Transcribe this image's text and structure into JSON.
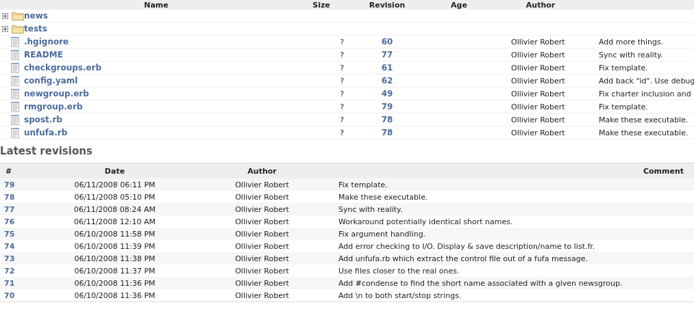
{
  "files": {
    "columns": [
      "Name",
      "Size",
      "Revision",
      "Age",
      "Author"
    ],
    "rows": [
      {
        "kind": "folder",
        "expanded": false,
        "name": "news"
      },
      {
        "kind": "folder",
        "expanded": false,
        "name": "tests"
      },
      {
        "kind": "file",
        "name": ".hgignore",
        "size": "?",
        "revision": "60",
        "author": "Ollivier Robert",
        "comment": "Add more things."
      },
      {
        "kind": "file",
        "name": "README",
        "size": "?",
        "revision": "77",
        "author": "Ollivier Robert",
        "comment": "Sync with reality."
      },
      {
        "kind": "file",
        "name": "checkgroups.erb",
        "size": "?",
        "revision": "61",
        "author": "Ollivier Robert",
        "comment": "Fix template."
      },
      {
        "kind": "file",
        "name": "config.yaml",
        "size": "?",
        "revision": "62",
        "author": "Ollivier Robert",
        "comment": "Add back \"id\". Use debug"
      },
      {
        "kind": "file",
        "name": "newgroup.erb",
        "size": "?",
        "revision": "49",
        "author": "Ollivier Robert",
        "comment": "Fix charter inclusion and"
      },
      {
        "kind": "file",
        "name": "rmgroup.erb",
        "size": "?",
        "revision": "79",
        "author": "Ollivier Robert",
        "comment": "Fix template."
      },
      {
        "kind": "file",
        "name": "spost.rb",
        "size": "?",
        "revision": "78",
        "author": "Ollivier Robert",
        "comment": "Make these executable."
      },
      {
        "kind": "file",
        "name": "unfufa.rb",
        "size": "?",
        "revision": "78",
        "author": "Ollivier Robert",
        "comment": "Make these executable."
      }
    ]
  },
  "latest_revisions": {
    "title": "Latest revisions",
    "columns": [
      "#",
      "Date",
      "Author",
      "Comment"
    ],
    "rows": [
      {
        "revision": "79",
        "date": "06/11/2008 06:11 PM",
        "author": "Ollivier Robert",
        "comment": "Fix template."
      },
      {
        "revision": "78",
        "date": "06/11/2008 05:10 PM",
        "author": "Ollivier Robert",
        "comment": "Make these executable."
      },
      {
        "revision": "77",
        "date": "06/11/2008 08:24 AM",
        "author": "Ollivier Robert",
        "comment": "Sync with reality."
      },
      {
        "revision": "76",
        "date": "06/11/2008 12:10 AM",
        "author": "Ollivier Robert",
        "comment": "Workaround potentially identical short names."
      },
      {
        "revision": "75",
        "date": "06/10/2008 11:58 PM",
        "author": "Ollivier Robert",
        "comment": "Fix argument handling."
      },
      {
        "revision": "74",
        "date": "06/10/2008 11:39 PM",
        "author": "Ollivier Robert",
        "comment": "Add error checking to I/O. Display & save description/name to list.fr."
      },
      {
        "revision": "73",
        "date": "06/10/2008 11:38 PM",
        "author": "Ollivier Robert",
        "comment": "Add unfufa.rb which extract the control file out of a fufa message."
      },
      {
        "revision": "72",
        "date": "06/10/2008 11:37 PM",
        "author": "Ollivier Robert",
        "comment": "Use files closer to the real ones."
      },
      {
        "revision": "71",
        "date": "06/10/2008 11:36 PM",
        "author": "Ollivier Robert",
        "comment": "Add #condense to find the short name associated with a given newsgroup."
      },
      {
        "revision": "70",
        "date": "06/10/2008 11:36 PM",
        "author": "Ollivier Robert",
        "comment": "Add \\n to both start/stop strings."
      }
    ]
  }
}
